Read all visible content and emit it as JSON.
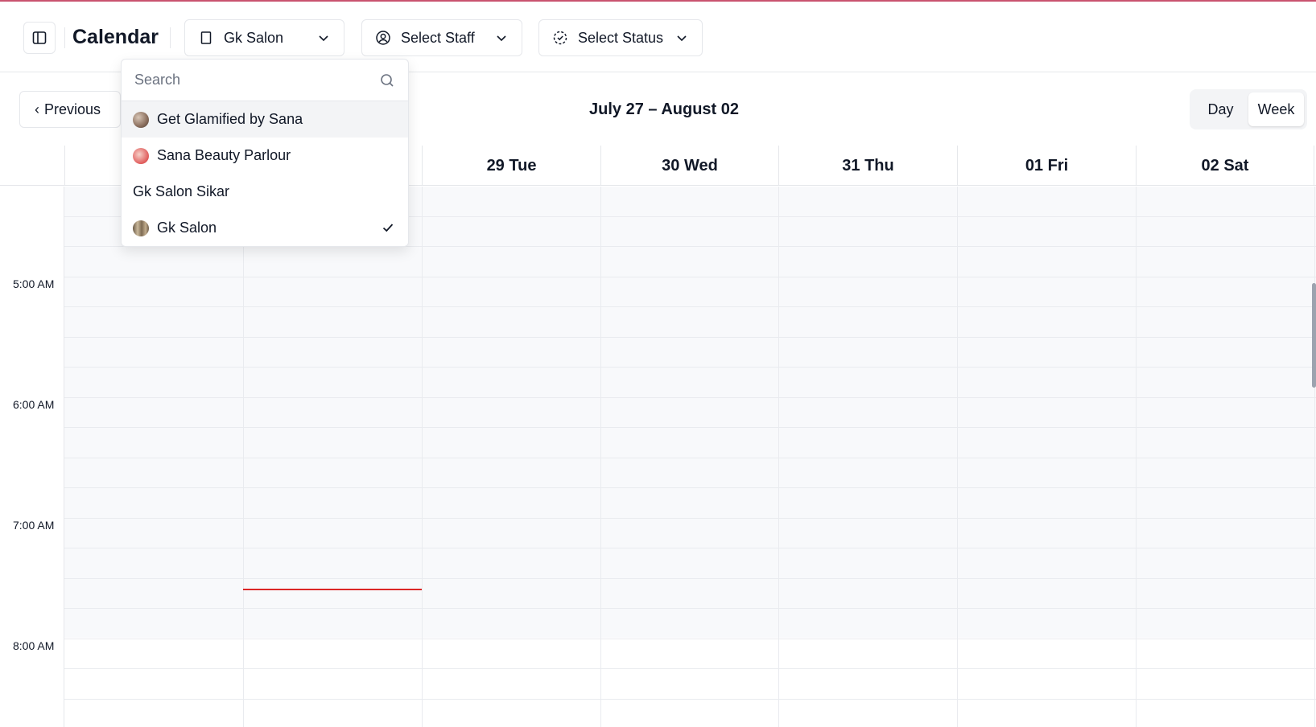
{
  "header": {
    "title": "Calendar",
    "location_dropdown": {
      "selected": "Gk Salon"
    },
    "staff_dropdown": {
      "label": "Select Staff"
    },
    "status_dropdown": {
      "label": "Select Status"
    }
  },
  "nav": {
    "previous_label": "Previous",
    "range_title": "July 27 – August 02",
    "views": [
      {
        "label": "Day",
        "active": false
      },
      {
        "label": "Week",
        "active": true
      }
    ]
  },
  "days": [
    {
      "label": ""
    },
    {
      "label": ""
    },
    {
      "label": "29 Tue"
    },
    {
      "label": "30 Wed"
    },
    {
      "label": "31 Thu"
    },
    {
      "label": "01 Fri"
    },
    {
      "label": "02 Sat"
    }
  ],
  "time_labels": [
    "5:00 AM",
    "6:00 AM",
    "7:00 AM",
    "8:00 AM"
  ],
  "location_popover": {
    "search_placeholder": "Search",
    "items": [
      {
        "label": "Get Glamified by Sana",
        "avatar_color": "#8b6f5e",
        "highlighted": true,
        "selected": false
      },
      {
        "label": "Sana Beauty Parlour",
        "avatar_color": "#e05a5a",
        "highlighted": false,
        "selected": false
      },
      {
        "label": "Gk Salon Sikar",
        "avatar_color": "",
        "highlighted": false,
        "selected": false
      },
      {
        "label": "Gk Salon",
        "avatar_color": "#9c8a72",
        "highlighted": false,
        "selected": true
      }
    ]
  },
  "colors": {
    "accent_top": "#c9536f",
    "current_time_line": "#dc2626"
  }
}
